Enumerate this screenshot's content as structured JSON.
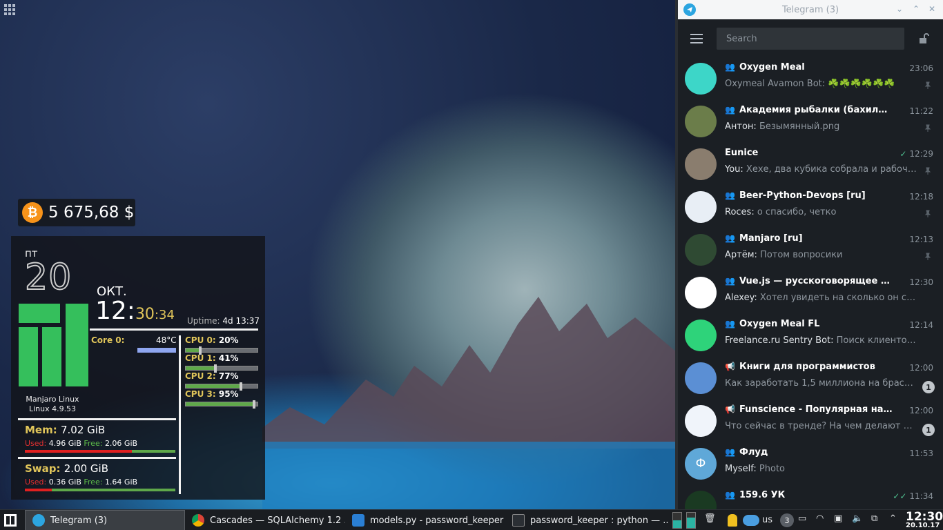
{
  "bitcoin": {
    "value": "5 675,68 $"
  },
  "conky": {
    "day": "пт",
    "date": "20",
    "month": "ОКТ.",
    "time_hour": "12:",
    "time_min": "30",
    "time_sec": ":34",
    "uptime_label": "Uptime:",
    "uptime_value": "4d 13:37",
    "os_name": "Manjaro Linux",
    "kernel": "Linux 4.9.53",
    "core_label": "Core 0:",
    "core_temp": "48°C",
    "cpus": [
      {
        "label": "CPU 0:",
        "value": "20%",
        "level": 0.2
      },
      {
        "label": "CPU 1:",
        "value": "41%",
        "level": 0.41
      },
      {
        "label": "CPU 2:",
        "value": "77%",
        "level": 0.77
      },
      {
        "label": "CPU 3:",
        "value": "95%",
        "level": 0.95
      }
    ],
    "mem": {
      "label": "Mem:",
      "total": "7.02 GiB",
      "used_label": "Used:",
      "used": "4.96 GiB",
      "free_label": "Free:",
      "free": "2.06 GiB",
      "used_fraction": 0.71
    },
    "swap": {
      "label": "Swap:",
      "total": "2.00 GiB",
      "used_label": "Used:",
      "used": "0.36 GiB",
      "free_label": "Free:",
      "free": "1.64 GiB",
      "used_fraction": 0.18
    }
  },
  "telegram": {
    "title": "Telegram (3)",
    "search_placeholder": "Search",
    "chats": [
      {
        "name": "Oxygen Meal",
        "group": true,
        "time": "23:06",
        "sender": "",
        "message": "Oxymeal Avamon Bot: ☘️☘️☘️☘️☘️☘️",
        "pinned": true,
        "avatar_color": "#3dd6c8",
        "avatar_text": ""
      },
      {
        "name": "Академия рыбалки (бахилы по ТР...",
        "group": true,
        "time": "11:22",
        "sender": "Антон:",
        "message": " Безымянный.png",
        "pinned": true,
        "avatar_color": "#6b7d4a",
        "avatar_text": ""
      },
      {
        "name": "Eunice",
        "group": false,
        "time": "12:29",
        "read": true,
        "sender": "You:",
        "message": " Хехе, два кубика собрала и рабочий ...",
        "pinned": true,
        "avatar_color": "#8a7d6e",
        "avatar_text": ""
      },
      {
        "name": "Beer-Python-Devops [ru]",
        "group": true,
        "time": "12:18",
        "sender": "Roces:",
        "message": " о спасибо, четко",
        "pinned": true,
        "avatar_color": "#e8eef5",
        "avatar_text": ""
      },
      {
        "name": "Manjaro [ru]",
        "group": true,
        "time": "12:13",
        "sender": "Артём:",
        "message": " Потом вопросики",
        "pinned": true,
        "avatar_color": "#2f4a33",
        "avatar_text": ""
      },
      {
        "name": "Vue.js — русскоговорящее сообще...",
        "group": true,
        "time": "12:30",
        "sender": "Alexey:",
        "message": " Хотел увидеть на сколько он симпотн...",
        "pinned": false,
        "avatar_color": "#ffffff",
        "avatar_text": ""
      },
      {
        "name": "Oxygen Meal FL",
        "group": true,
        "time": "12:14",
        "sender": "Freelance.ru Sentry Bot:",
        "message": " Поиск клиентов Поиск...",
        "pinned": false,
        "avatar_color": "#2ed37a",
        "avatar_text": ""
      },
      {
        "name": "Книги для программистов",
        "channel": true,
        "time": "12:00",
        "sender": "",
        "message": "Как заработать 1,5 миллиона на браслети...",
        "badge": "1",
        "avatar_color": "#5b8fd4",
        "avatar_text": ""
      },
      {
        "name": "Funscience - Популярная наука, но...",
        "channel": true,
        "time": "12:00",
        "sender": "",
        "message": "Что сейчас в тренде? На чем делают милл...",
        "badge": "1",
        "avatar_color": "#f0f4fa",
        "avatar_text": ""
      },
      {
        "name": "Флуд",
        "group": true,
        "time": "11:53",
        "sender": "Myself:",
        "message": " Photo",
        "pinned": false,
        "avatar_color": "#5fa8d8",
        "avatar_text": "Ф"
      },
      {
        "name": "159.6 УК",
        "group": true,
        "time": "11:34",
        "read2": true,
        "sender": "",
        "message": "",
        "pinned": false,
        "avatar_color": "#1a3a22",
        "avatar_text": ""
      }
    ]
  },
  "taskbar": {
    "items": [
      {
        "label": "Telegram (3)",
        "icon": "telegram-icon",
        "active": true
      },
      {
        "label": "Cascades — SQLAlchemy 1.2 ...",
        "icon": "chrome-icon",
        "active": false
      },
      {
        "label": "models.py - password_keeper ...",
        "icon": "vscode-icon",
        "active": false
      },
      {
        "label": "password_keeper : python — ...",
        "icon": "terminal-icon",
        "active": false
      }
    ],
    "tray_notifications": "3",
    "keyboard_layout": "us",
    "clock_time": "12:30",
    "clock_date": "20.10.17"
  }
}
